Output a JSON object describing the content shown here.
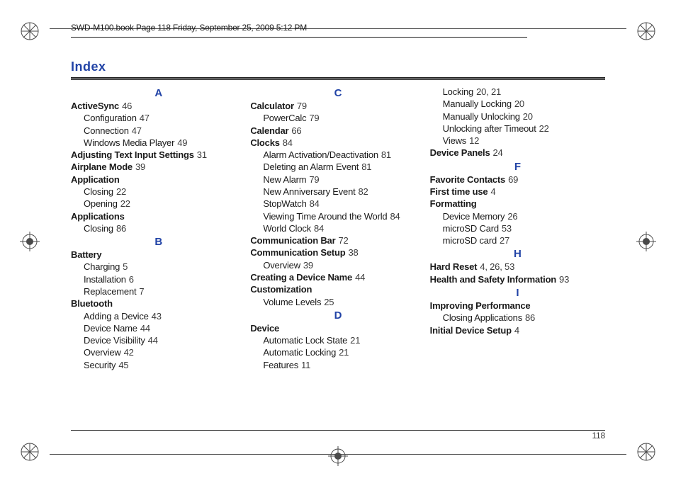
{
  "running_header": "SWD-M100.book  Page 118  Friday, September 25, 2009  5:12 PM",
  "index_title": "Index",
  "page_number": "118",
  "columns": [
    {
      "blocks": [
        {
          "letter": "A"
        },
        {
          "top": {
            "t": "ActiveSync",
            "p": "46"
          },
          "subs": [
            {
              "t": "Configuration",
              "p": "47"
            },
            {
              "t": "Connection",
              "p": "47"
            },
            {
              "t": "Windows Media Player",
              "p": "49"
            }
          ]
        },
        {
          "top": {
            "t": "Adjusting Text Input Settings",
            "p": "31"
          }
        },
        {
          "top": {
            "t": "Airplane Mode",
            "p": "39"
          }
        },
        {
          "top": {
            "t": "Application"
          },
          "subs": [
            {
              "t": "Closing",
              "p": "22"
            },
            {
              "t": "Opening",
              "p": "22"
            }
          ]
        },
        {
          "top": {
            "t": "Applications"
          },
          "subs": [
            {
              "t": "Closing",
              "p": "86"
            }
          ]
        },
        {
          "letter": "B"
        },
        {
          "top": {
            "t": "Battery"
          },
          "subs": [
            {
              "t": "Charging",
              "p": "5"
            },
            {
              "t": "Installation",
              "p": "6"
            },
            {
              "t": "Replacement",
              "p": "7"
            }
          ]
        },
        {
          "top": {
            "t": "Bluetooth"
          },
          "subs": [
            {
              "t": "Adding a Device",
              "p": "43"
            },
            {
              "t": "Device Name",
              "p": "44"
            },
            {
              "t": "Device Visibility",
              "p": "44"
            },
            {
              "t": "Overview",
              "p": "42"
            },
            {
              "t": "Security",
              "p": "45"
            }
          ]
        }
      ]
    },
    {
      "blocks": [
        {
          "letter": "C"
        },
        {
          "top": {
            "t": "Calculator",
            "p": "79"
          },
          "subs": [
            {
              "t": "PowerCalc",
              "p": "79"
            }
          ]
        },
        {
          "top": {
            "t": "Calendar",
            "p": "66"
          }
        },
        {
          "top": {
            "t": "Clocks",
            "p": "84"
          },
          "subs": [
            {
              "t": "Alarm Activation/Deactivation",
              "p": "81"
            },
            {
              "t": "Deleting an Alarm Event",
              "p": "81"
            },
            {
              "t": "New Alarm",
              "p": "79"
            },
            {
              "t": "New Anniversary Event",
              "p": "82"
            },
            {
              "t": "StopWatch",
              "p": "84"
            },
            {
              "t": "Viewing Time Around the World",
              "p": "84"
            },
            {
              "t": "World Clock",
              "p": "84"
            }
          ]
        },
        {
          "top": {
            "t": "Communication Bar",
            "p": "72"
          }
        },
        {
          "top": {
            "t": "Communication Setup",
            "p": "38"
          },
          "subs": [
            {
              "t": "Overview",
              "p": "39"
            }
          ]
        },
        {
          "top": {
            "t": "Creating a Device Name",
            "p": "44"
          }
        },
        {
          "top": {
            "t": "Customization"
          },
          "subs": [
            {
              "t": "Volume Levels",
              "p": "25"
            }
          ]
        },
        {
          "letter": "D"
        },
        {
          "top": {
            "t": "Device"
          },
          "subs": [
            {
              "t": "Automatic Lock State",
              "p": "21"
            },
            {
              "t": "Automatic Locking",
              "p": "21"
            },
            {
              "t": "Features",
              "p": "11"
            }
          ]
        }
      ]
    },
    {
      "blocks": [
        {
          "continuation": true,
          "subs": [
            {
              "t": "Locking",
              "p": "20, 21"
            },
            {
              "t": "Manually Locking",
              "p": "20"
            },
            {
              "t": "Manually Unlocking",
              "p": "20"
            },
            {
              "t": "Unlocking after Timeout",
              "p": "22"
            },
            {
              "t": "Views",
              "p": "12"
            }
          ]
        },
        {
          "top": {
            "t": "Device Panels",
            "p": "24"
          }
        },
        {
          "letter": "F"
        },
        {
          "top": {
            "t": "Favorite Contacts",
            "p": "69"
          }
        },
        {
          "top": {
            "t": "First time use",
            "p": "4"
          }
        },
        {
          "top": {
            "t": "Formatting"
          },
          "subs": [
            {
              "t": "Device Memory",
              "p": "26"
            },
            {
              "t": "microSD Card",
              "p": "53"
            },
            {
              "t": "microSD card",
              "p": "27"
            }
          ]
        },
        {
          "letter": "H"
        },
        {
          "top": {
            "t": "Hard Reset",
            "p": "4, 26, 53"
          }
        },
        {
          "top": {
            "t": "Health and Safety Information",
            "p": "93"
          }
        },
        {
          "letter": "I"
        },
        {
          "top": {
            "t": "Improving Performance"
          },
          "subs": [
            {
              "t": "Closing Applications",
              "p": "86"
            }
          ]
        },
        {
          "top": {
            "t": "Initial Device Setup",
            "p": "4"
          }
        }
      ]
    }
  ]
}
